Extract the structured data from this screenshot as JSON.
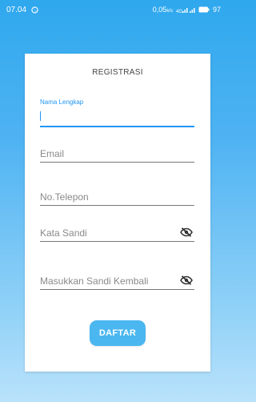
{
  "status_bar": {
    "time": "07.04",
    "data_speed": "0,05",
    "battery": "97"
  },
  "form": {
    "title": "REGISTRASI",
    "fields": [
      {
        "label": "Nama Lengkap",
        "value": "",
        "placeholder": ""
      },
      {
        "value": "",
        "placeholder": "Email"
      },
      {
        "value": "",
        "placeholder": "No.Telepon"
      },
      {
        "value": "",
        "placeholder": "Kata Sandi"
      },
      {
        "value": "",
        "placeholder": "Masukkan Sandi Kembali"
      }
    ],
    "submit_label": "DAFTAR"
  },
  "icons": {
    "eye_toggle": "eye-off-icon",
    "status": [
      "whatsapp-icon",
      "signal-icon",
      "battery-icon"
    ]
  },
  "colors": {
    "accent": "#2196f3",
    "button": "#4ab7f0",
    "background_top": "#2fa8ee",
    "background_bottom": "#b9e2fb"
  }
}
